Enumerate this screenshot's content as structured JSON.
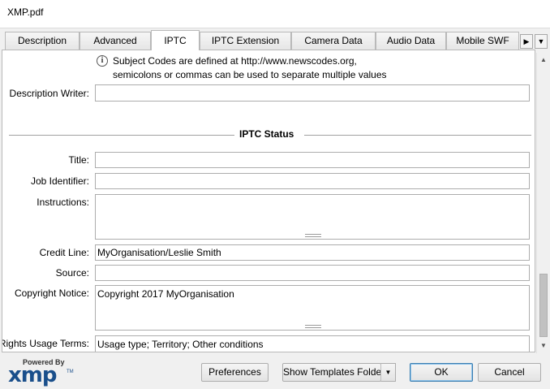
{
  "window": {
    "title": "XMP.pdf"
  },
  "tabs": [
    {
      "label": "Description"
    },
    {
      "label": "Advanced"
    },
    {
      "label": "IPTC"
    },
    {
      "label": "IPTC Extension"
    },
    {
      "label": "Camera Data"
    },
    {
      "label": "Audio Data"
    },
    {
      "label": "Mobile SWF"
    }
  ],
  "active_tab": "IPTC",
  "tab_nav": {
    "next_icon": "triangle-right",
    "menu_icon": "triangle-down"
  },
  "info": {
    "icon": "info-icon",
    "line1": "Subject Codes are defined at http://www.newscodes.org,",
    "line2": "semicolons or commas can be used to separate multiple values"
  },
  "fields": {
    "description_writer": {
      "label": "Description Writer:",
      "value": ""
    },
    "title": {
      "label": "Title:",
      "value": ""
    },
    "job_identifier": {
      "label": "Job Identifier:",
      "value": ""
    },
    "instructions": {
      "label": "Instructions:",
      "value": ""
    },
    "credit_line": {
      "label": "Credit Line:",
      "value": "MyOrganisation/Leslie Smith"
    },
    "source": {
      "label": "Source:",
      "value": ""
    },
    "copyright_notice": {
      "label": "Copyright Notice:",
      "value": "Copyright 2017 MyOrganisation"
    },
    "rights_usage_terms": {
      "label": "Rights Usage Terms:",
      "value": "Usage type; Territory; Other conditions"
    }
  },
  "section": {
    "title": "IPTC Status"
  },
  "logo": {
    "powered_by": "Powered By",
    "name": "xmp",
    "tm": "TM"
  },
  "buttons": {
    "preferences": "Preferences",
    "show_templates_folder": "Show Templates Folder",
    "ok": "OK",
    "cancel": "Cancel"
  }
}
